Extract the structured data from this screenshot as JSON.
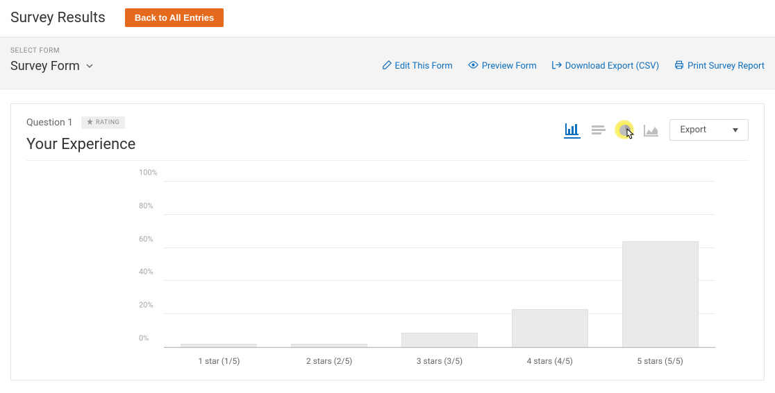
{
  "header": {
    "title": "Survey Results",
    "back_button": "Back to All Entries"
  },
  "filter": {
    "label": "SELECT FORM",
    "selected_form": "Survey Form"
  },
  "actions": {
    "edit": "Edit This Form",
    "preview": "Preview Form",
    "download": "Download Export (CSV)",
    "print": "Print Survey Report"
  },
  "question": {
    "number": "Question 1",
    "badge": "RATING",
    "title": "Your Experience",
    "export_label": "Export"
  },
  "chart_data": {
    "type": "bar",
    "categories": [
      "1 star (1/5)",
      "2 stars (2/5)",
      "3 stars (3/5)",
      "4 stars (4/5)",
      "5 stars (5/5)"
    ],
    "values": [
      2,
      2,
      9,
      23,
      64
    ],
    "xlabel": "",
    "ylabel": "",
    "ylim": [
      0,
      100
    ],
    "yticks": [
      "0%",
      "20%",
      "40%",
      "60%",
      "80%",
      "100%"
    ]
  }
}
